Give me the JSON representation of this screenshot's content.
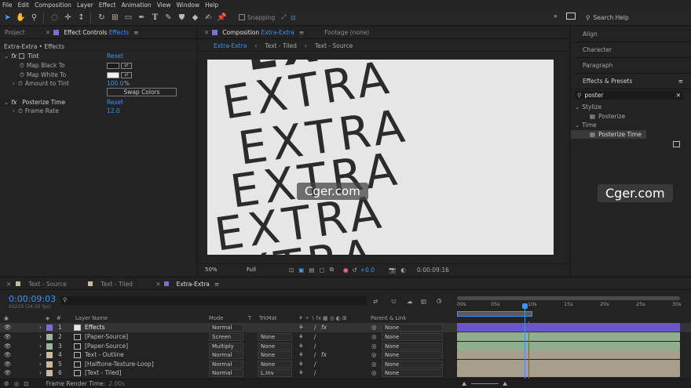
{
  "menu": [
    "File",
    "Edit",
    "Composition",
    "Layer",
    "Effect",
    "Animation",
    "View",
    "Window",
    "Help"
  ],
  "toolbar": {
    "snapping": "Snapping",
    "search_help": "Search Help"
  },
  "left_panel": {
    "tab_project": "Project",
    "tab_effect_controls": "Effect Controls",
    "tab_effect_controls_target": "Effects",
    "breadcrumb": "Extra-Extra • Effects",
    "tint": {
      "label": "Tint",
      "reset": "Reset",
      "map_black": "Map Black To",
      "map_white": "Map White To",
      "amount": "Amount to Tint",
      "amount_value": "100.0",
      "amount_unit": "%",
      "swap": "Swap Colors"
    },
    "posterize": {
      "label": "Posterize Time",
      "reset": "Reset",
      "frame_rate": "Frame Rate",
      "frame_rate_value": "12.0"
    }
  },
  "comp_panel": {
    "tab_composition": "Composition",
    "tab_comp_name": "Extra-Extra",
    "tab_footage": "Footage",
    "tab_footage_value": "(none)",
    "crumbs": [
      "Extra-Extra",
      "Text - Tiled",
      "Text - Source"
    ],
    "words": [
      "EXTRA",
      "EXTRA",
      "EXTRA",
      "EXTRA",
      "EXTRA",
      "EXTRA"
    ],
    "watermark": "Cger.com",
    "zoom": "50%",
    "resolution": "Full",
    "exposure": "+0.0",
    "timecode": "0:00:09:16"
  },
  "right_panel": {
    "align": "Align",
    "character": "Character",
    "paragraph": "Paragraph",
    "effects_presets": "Effects & Presets",
    "search_value": "poster",
    "tree": [
      {
        "group": "Stylize",
        "item": "Posterize"
      },
      {
        "group": "Time",
        "item": "Posterize Time"
      }
    ],
    "watermark": "Cger.com"
  },
  "timeline": {
    "tabs": [
      "Text - Source",
      "Text - Tiled",
      "Extra-Extra"
    ],
    "timecode": "0:00:09:03",
    "frame_info": "00219 (24.00 fps)",
    "headers": {
      "layer_name": "Layer Name",
      "mode": "Mode",
      "t": "T",
      "trkmat": "TrkMat",
      "parent": "Parent & Link"
    },
    "ruler": [
      "00s",
      "05s",
      "10s",
      "15s",
      "20s",
      "25s",
      "30s"
    ],
    "layers": [
      {
        "num": "1",
        "name": "Effects",
        "mode": "Normal",
        "trkmat": "",
        "parent": "None",
        "color": "#7a6fd6",
        "track": "#6a55c9"
      },
      {
        "num": "2",
        "name": "[Paper-Source]",
        "mode": "Screen",
        "trkmat": "None",
        "parent": "None",
        "color": "#9bb99a",
        "track": "#8fae8d"
      },
      {
        "num": "3",
        "name": "[Paper-Source]",
        "mode": "Multiply",
        "trkmat": "None",
        "parent": "None",
        "color": "#9bb99a",
        "track": "#8fae8d"
      },
      {
        "num": "4",
        "name": "Text - Outline",
        "mode": "Normal",
        "trkmat": "None",
        "parent": "None",
        "color": "#c9b9a0",
        "track": "#a89e8c"
      },
      {
        "num": "5",
        "name": "[Halftone-Texture-Loop]",
        "mode": "Normal",
        "trkmat": "None",
        "parent": "None",
        "color": "#c9b9a0",
        "track": "#a89e8c"
      },
      {
        "num": "6",
        "name": "[Text - Tiled]",
        "mode": "Normal",
        "trkmat": "L.Inv",
        "parent": "None",
        "color": "#c9b9a0",
        "track": "#a89e8c"
      }
    ],
    "render_time_label": "Frame Render Time:",
    "render_time_value": "2.00s"
  }
}
